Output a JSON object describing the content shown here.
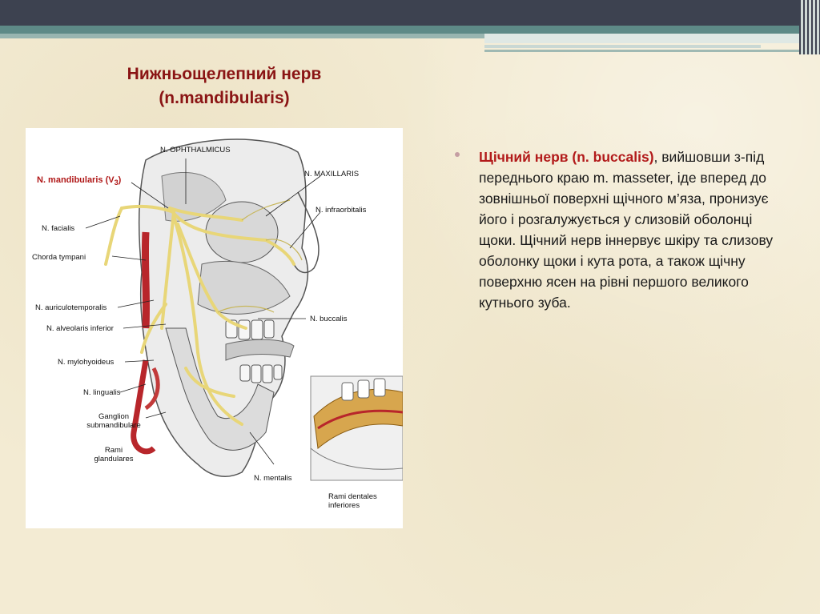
{
  "title": {
    "line1": "Нижньощелепний нерв",
    "line2": "(n.mandibularis)"
  },
  "figure": {
    "labels": {
      "ophthalmicus": "N. OPHTHALMICUS",
      "maxillaris": "N. MAXILLARIS",
      "mandibularis": "N. mandibularis (V",
      "mandibularis_sub": "3",
      "mandibularis_close": ")",
      "infraorbitalis": "N. infraorbitalis",
      "facialis": "N. facialis",
      "chorda": "Chorda tympani",
      "auriculotemporalis": "N. auriculotemporalis",
      "alveolaris": "N. alveolaris inferior",
      "buccalis": "N. buccalis",
      "mylohyoideus": "N. mylohyoideus",
      "lingualis": "N. lingualis",
      "ganglion_1": "Ganglion",
      "ganglion_2": "submandibulare",
      "rami_gl_1": "Rami",
      "rami_gl_2": "glandulares",
      "mentalis": "N. mentalis",
      "rami_dent_1": "Rami dentales",
      "rami_dent_2": "inferiores"
    }
  },
  "content": {
    "highlight": "Щічний нерв (n. buccalis)",
    "rest": ", вийшовши з-під переднього краю m. masseter, іде вперед до зовнішньої поверхні щічного м’яза, пронизує його і розгалужується у слизовій оболонці щоки. Щічний нерв іннервує шкіру та слизову оболонку щоки і кута рота, а також щічну поверхню ясен на рівні першого великого кутнього зуба."
  }
}
